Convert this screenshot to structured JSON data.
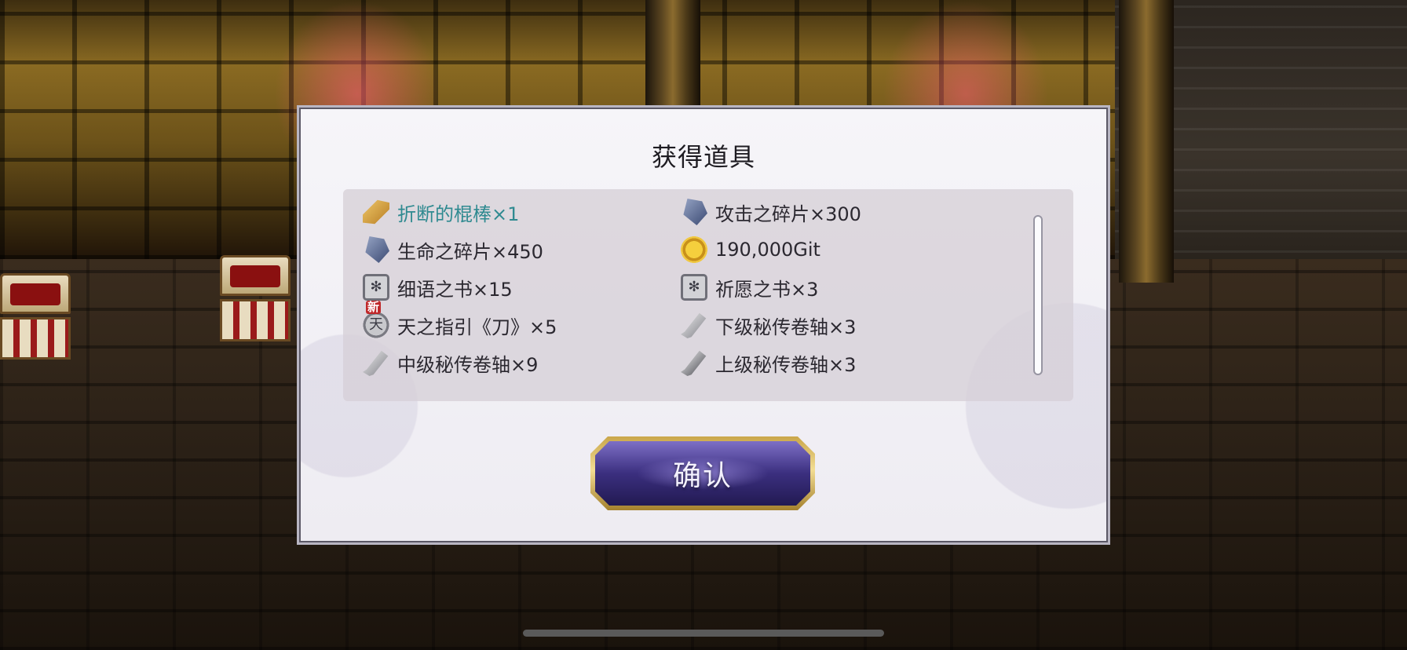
{
  "dialog": {
    "title": "获得道具",
    "confirm_label": "确认"
  },
  "items": [
    {
      "icon": "broken-stick-icon",
      "label": "折断的棍棒×1",
      "highlight": true
    },
    {
      "icon": "attack-shard-icon",
      "label": "攻击之碎片×300"
    },
    {
      "icon": "life-shard-icon",
      "label": "生命之碎片×450"
    },
    {
      "icon": "gold-coin-icon",
      "label": "190,000Git"
    },
    {
      "icon": "book-icon",
      "label": "细语之书×15"
    },
    {
      "icon": "book-icon",
      "label": "祈愿之书×3"
    },
    {
      "icon": "heaven-guide-icon",
      "label": "天之指引《刀》×5",
      "badge": "新"
    },
    {
      "icon": "scroll-icon",
      "label": "下级秘传卷轴×3"
    },
    {
      "icon": "scroll-icon",
      "label": "中级秘传卷轴×9"
    },
    {
      "icon": "scroll-icon",
      "label": "上级秘传卷轴×3"
    }
  ],
  "colors": {
    "highlight_text": "#2f8a90",
    "button_fill": "#3b2f7f",
    "button_border": "#d9bd68"
  }
}
